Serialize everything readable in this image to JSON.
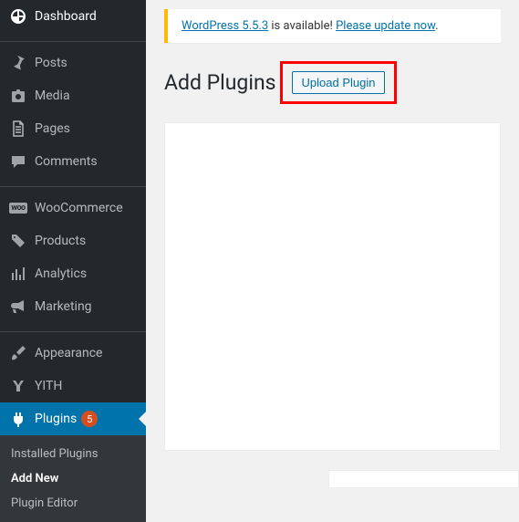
{
  "notice": {
    "prefix": "WordPress 5.5.3",
    "mid": " is available! ",
    "link": "Please update now",
    "suffix": "."
  },
  "page": {
    "title": "Add Plugins",
    "upload_button": "Upload Plugin"
  },
  "sidebar": {
    "items": [
      {
        "label": "Dashboard"
      },
      {
        "label": "Posts"
      },
      {
        "label": "Media"
      },
      {
        "label": "Pages"
      },
      {
        "label": "Comments"
      },
      {
        "label": "WooCommerce"
      },
      {
        "label": "Products"
      },
      {
        "label": "Analytics"
      },
      {
        "label": "Marketing"
      },
      {
        "label": "Appearance"
      },
      {
        "label": "YITH"
      },
      {
        "label": "Plugins",
        "badge": "5"
      }
    ],
    "submenu": [
      {
        "label": "Installed Plugins"
      },
      {
        "label": "Add New"
      },
      {
        "label": "Plugin Editor"
      }
    ]
  }
}
